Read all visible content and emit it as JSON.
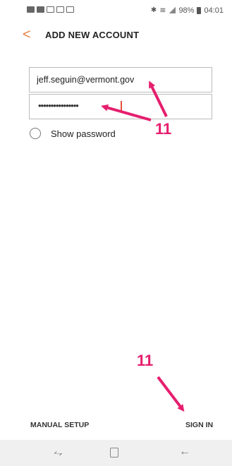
{
  "status_bar": {
    "time": "04:01",
    "battery": "98%",
    "icons_left": [
      "gallery-icon",
      "camera-icon",
      "image-icon",
      "flipboard-icon",
      "calendar-icon"
    ]
  },
  "header": {
    "title": "ADD NEW ACCOUNT",
    "back_icon": "<"
  },
  "form": {
    "email_value": "jeff.seguin@vermont.gov",
    "password_masked": "••••••••••••••••",
    "show_password_label": "Show password"
  },
  "annotations": {
    "step_label_top": "11",
    "step_label_bottom": "11",
    "color": "#e61e6e"
  },
  "footer": {
    "manual_setup_label": "MANUAL SETUP",
    "sign_in_label": "SIGN IN"
  },
  "navbar": {
    "recent_icon": "recent-apps-icon",
    "home_icon": "home-icon",
    "back_icon": "back-icon"
  },
  "colors": {
    "accent_back": "#e87f3d",
    "caret": "#e2503a",
    "annotation": "#e61e6e"
  }
}
